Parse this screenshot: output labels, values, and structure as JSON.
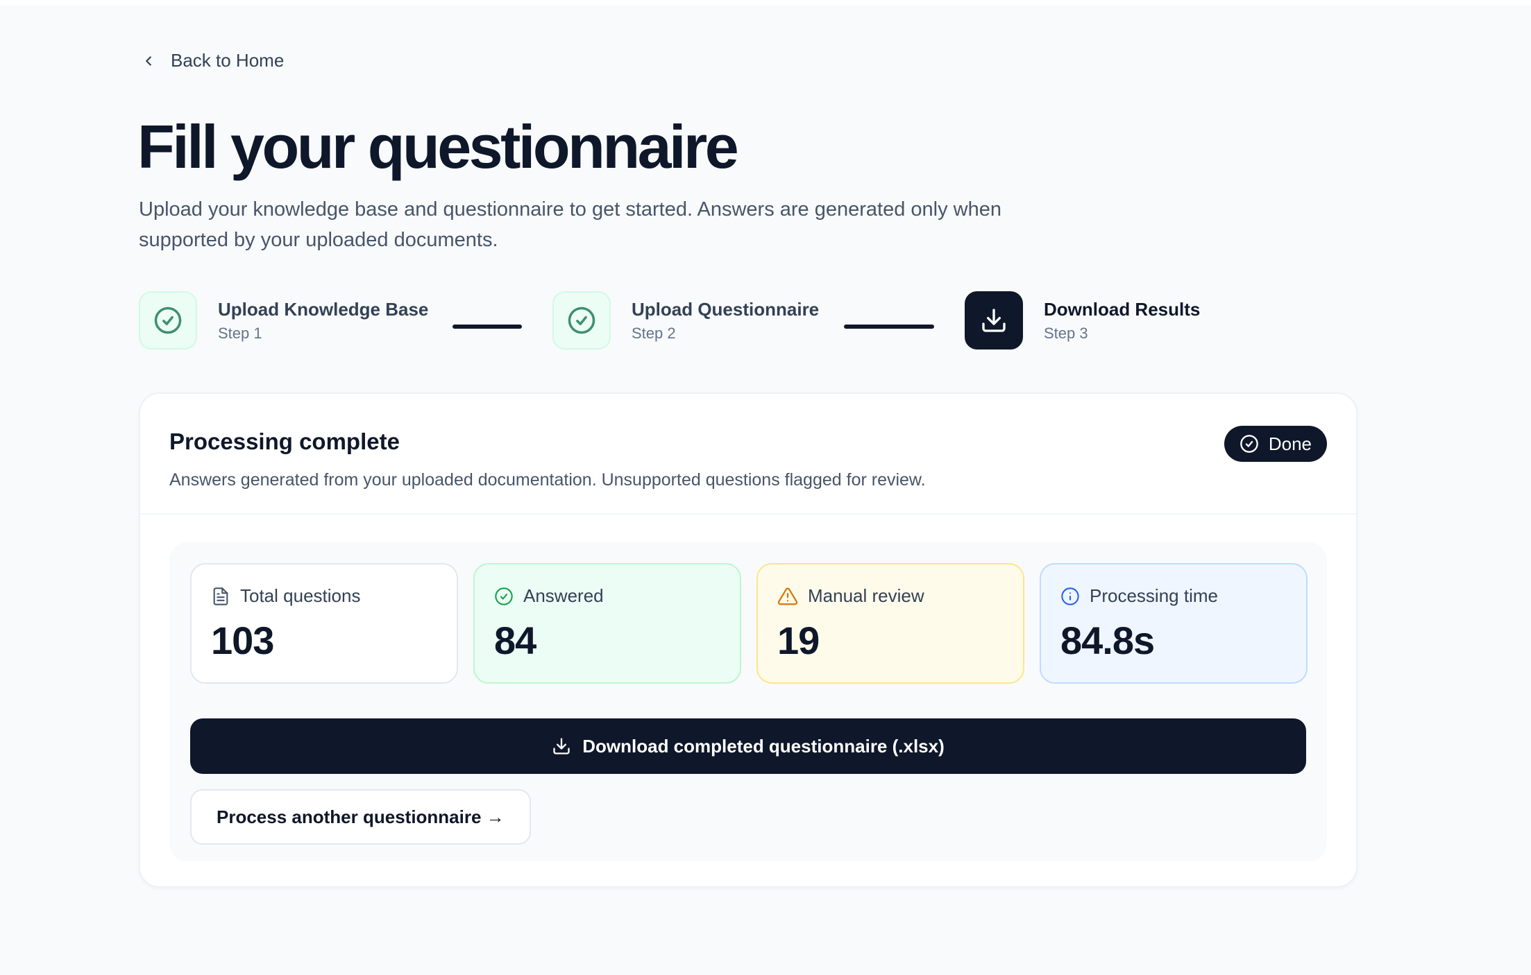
{
  "nav": {
    "back_label": "Back to Home"
  },
  "header": {
    "title": "Fill your questionnaire",
    "subtitle": "Upload your knowledge base and questionnaire to get started. Answers are generated only when supported by your uploaded documents."
  },
  "stepper": {
    "steps": [
      {
        "title": "Upload Knowledge Base",
        "sub": "Step 1",
        "state": "complete",
        "icon": "check-circle-icon"
      },
      {
        "title": "Upload Questionnaire",
        "sub": "Step 2",
        "state": "complete",
        "icon": "check-circle-icon"
      },
      {
        "title": "Download Results",
        "sub": "Step 3",
        "state": "active",
        "icon": "download-icon"
      }
    ]
  },
  "result_card": {
    "title": "Processing complete",
    "description": "Answers generated from your uploaded documentation. Unsupported questions flagged for review.",
    "badge": "Done",
    "stats": [
      {
        "label": "Total questions",
        "value": "103",
        "icon": "file-text-icon"
      },
      {
        "label": "Answered",
        "value": "84",
        "icon": "check-circle-icon"
      },
      {
        "label": "Manual review",
        "value": "19",
        "icon": "alert-triangle-icon"
      },
      {
        "label": "Processing time",
        "value": "84.8s",
        "icon": "info-icon"
      }
    ],
    "download_label": "Download completed questionnaire (.xlsx)",
    "process_another_label": "Process another questionnaire →"
  },
  "colors": {
    "primary": "#0f172a",
    "success": "#16a34a",
    "warning": "#d97706",
    "info": "#2563eb"
  }
}
